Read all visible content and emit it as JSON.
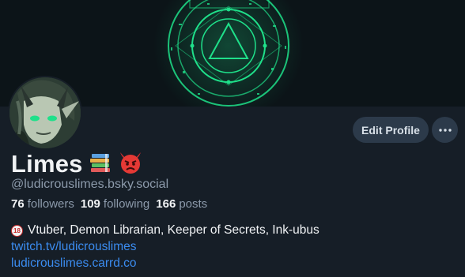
{
  "profile": {
    "display_name": "Limes",
    "handle": "@ludicrouslimes.bsky.social",
    "stats": {
      "followers_count": "76",
      "followers_label": "followers",
      "following_count": "109",
      "following_label": "following",
      "posts_count": "166",
      "posts_label": "posts"
    },
    "bio": {
      "line1": "Vtuber, Demon Librarian, Keeper of Secrets, Ink-ubus",
      "badge": "18",
      "links": [
        "twitch.tv/ludicrouslimes",
        "ludicrouslimes.carrd.co"
      ]
    },
    "name_emojis": [
      "books-icon",
      "angry-devil-icon"
    ]
  },
  "actions": {
    "edit_label": "Edit Profile",
    "more_icon": "ellipsis-icon"
  },
  "colors": {
    "background": "#161e27",
    "banner": "#0c1418",
    "banner_glow": "#1fe08a",
    "button_bg": "#2c3a4a",
    "link": "#3b8cf0",
    "muted_text": "#8c9aab"
  }
}
